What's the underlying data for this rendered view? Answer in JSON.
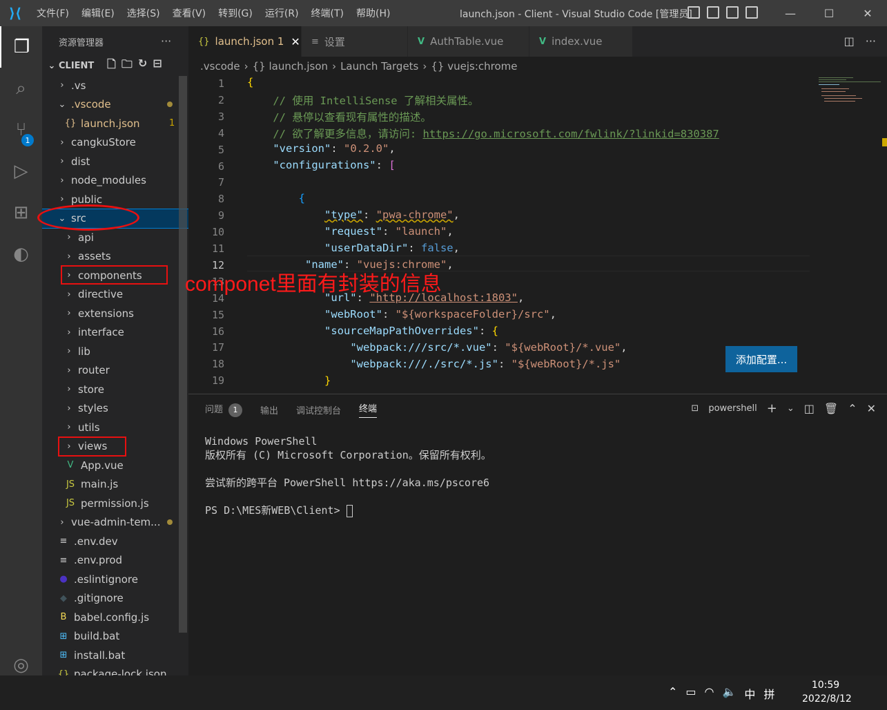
{
  "titlebar": {
    "menu": [
      "文件(F)",
      "编辑(E)",
      "选择(S)",
      "查看(V)",
      "转到(G)",
      "运行(R)",
      "终端(T)",
      "帮助(H)"
    ],
    "title": "launch.json - Client - Visual Studio Code [管理员]"
  },
  "activitybar": {
    "scm_badge": "1"
  },
  "sidebar": {
    "header": "资源管理器",
    "section": "CLIENT",
    "tree": [
      {
        "label": ".vs",
        "chev": "›",
        "indent": 0
      },
      {
        "label": ".vscode",
        "chev": "⌄",
        "indent": 0,
        "color": "#e2c08d",
        "dot": true
      },
      {
        "label": "launch.json",
        "icon": "{}",
        "indent": 1,
        "color": "#e2c08d",
        "num": "1"
      },
      {
        "label": "cangkuStore",
        "chev": "›",
        "indent": 0
      },
      {
        "label": "dist",
        "chev": "›",
        "indent": 0
      },
      {
        "label": "node_modules",
        "chev": "›",
        "indent": 0
      },
      {
        "label": "public",
        "chev": "›",
        "indent": 0
      },
      {
        "label": "src",
        "chev": "⌄",
        "indent": 0,
        "selected": true
      },
      {
        "label": "api",
        "chev": "›",
        "indent": 1
      },
      {
        "label": "assets",
        "chev": "›",
        "indent": 1
      },
      {
        "label": "components",
        "chev": "›",
        "indent": 1
      },
      {
        "label": "directive",
        "chev": "›",
        "indent": 1
      },
      {
        "label": "extensions",
        "chev": "›",
        "indent": 1
      },
      {
        "label": "interface",
        "chev": "›",
        "indent": 1
      },
      {
        "label": "lib",
        "chev": "›",
        "indent": 1
      },
      {
        "label": "router",
        "chev": "›",
        "indent": 1
      },
      {
        "label": "store",
        "chev": "›",
        "indent": 1
      },
      {
        "label": "styles",
        "chev": "›",
        "indent": 1
      },
      {
        "label": "utils",
        "chev": "›",
        "indent": 1
      },
      {
        "label": "views",
        "chev": "›",
        "indent": 1
      },
      {
        "label": "App.vue",
        "icon": "V",
        "iconColor": "#41b883",
        "indent": 1
      },
      {
        "label": "main.js",
        "icon": "JS",
        "iconColor": "#cbcb41",
        "indent": 1
      },
      {
        "label": "permission.js",
        "icon": "JS",
        "iconColor": "#cbcb41",
        "indent": 1
      },
      {
        "label": "vue-admin-tem...",
        "chev": "›",
        "indent": 0,
        "dot": true
      },
      {
        "label": ".env.dev",
        "icon": "≡",
        "iconColor": "#cccccc",
        "indent": 0
      },
      {
        "label": ".env.prod",
        "icon": "≡",
        "iconColor": "#cccccc",
        "indent": 0
      },
      {
        "label": ".eslintignore",
        "icon": "●",
        "iconColor": "#4b32c3",
        "indent": 0
      },
      {
        "label": ".gitignore",
        "icon": "◆",
        "iconColor": "#41535b",
        "indent": 0
      },
      {
        "label": "babel.config.js",
        "icon": "B",
        "iconColor": "#f5da55",
        "indent": 0
      },
      {
        "label": "build.bat",
        "icon": "⊞",
        "iconColor": "#4fc1ff",
        "indent": 0
      },
      {
        "label": "install.bat",
        "icon": "⊞",
        "iconColor": "#4fc1ff",
        "indent": 0
      },
      {
        "label": "package-lock.json",
        "icon": "{}",
        "iconColor": "#cbcb41",
        "indent": 0
      }
    ]
  },
  "tabs": [
    {
      "icon": "{}",
      "label": "launch.json 1",
      "active": true
    },
    {
      "icon": "≡",
      "label": "设置"
    },
    {
      "icon": "V",
      "label": "AuthTable.vue"
    },
    {
      "icon": "V",
      "label": "index.vue"
    }
  ],
  "breadcrumb": [
    ".vscode",
    "›",
    "{} launch.json",
    "›",
    "Launch Targets",
    "›",
    "{} vuejs:chrome"
  ],
  "editor": {
    "line_numbers": [
      "1",
      "2",
      "3",
      "4",
      "5",
      "6",
      "7",
      "8",
      "9",
      "10",
      "11",
      "12",
      "13",
      "14",
      "15",
      "16",
      "17",
      "18",
      "19"
    ],
    "add_config_button": "添加配置..."
  },
  "panel": {
    "tabs": [
      "问题",
      "输出",
      "调试控制台",
      "终端"
    ],
    "problems_count": "1",
    "shell": "powershell",
    "terminal_lines": [
      "Windows PowerShell",
      "版权所有 (C) Microsoft Corporation。保留所有权利。",
      "",
      "尝试新的跨平台 PowerShell https://aka.ms/pscore6",
      "",
      "PS D:\\MES新WEB\\Client> "
    ]
  },
  "taskbar": {
    "ime1": "中",
    "ime2": "拼",
    "time": "10:59",
    "date": "2022/8/12"
  },
  "annotation": {
    "text": "componet里面有封装的信息"
  }
}
